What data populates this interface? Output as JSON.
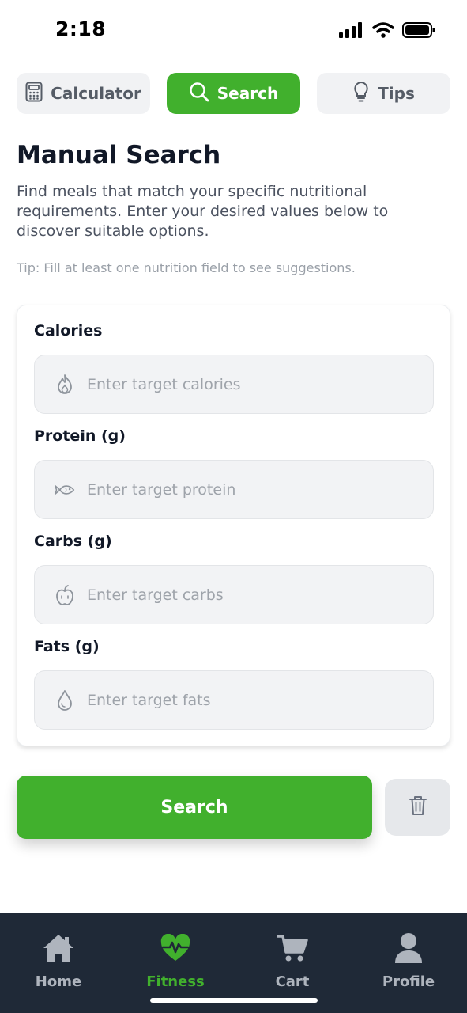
{
  "status_bar": {
    "time": "2:18"
  },
  "tabs": [
    {
      "label": "Calculator",
      "icon": "calculator-icon",
      "active": false
    },
    {
      "label": "Search",
      "icon": "search-icon",
      "active": true
    },
    {
      "label": "Tips",
      "icon": "lightbulb-icon",
      "active": false
    }
  ],
  "page": {
    "title": "Manual Search",
    "description": "Find meals that match your specific nutritional requirements. Enter your desired values below to discover suitable options.",
    "tip": "Tip: Fill at least one nutrition field to see suggestions."
  },
  "fields": [
    {
      "label": "Calories",
      "placeholder": "Enter target calories",
      "value": "",
      "icon": "flame-icon"
    },
    {
      "label": "Protein (g)",
      "placeholder": "Enter target protein",
      "value": "",
      "icon": "fish-icon"
    },
    {
      "label": "Carbs (g)",
      "placeholder": "Enter target carbs",
      "value": "",
      "icon": "apple-icon"
    },
    {
      "label": "Fats (g)",
      "placeholder": "Enter target fats",
      "value": "",
      "icon": "droplet-icon"
    }
  ],
  "actions": {
    "search_label": "Search",
    "clear_icon": "trash-icon"
  },
  "bottom_nav": [
    {
      "label": "Home",
      "icon": "home-icon",
      "active": false
    },
    {
      "label": "Fitness",
      "icon": "heart-pulse-icon",
      "active": true
    },
    {
      "label": "Cart",
      "icon": "cart-icon",
      "active": false
    },
    {
      "label": "Profile",
      "icon": "user-icon",
      "active": false
    }
  ],
  "colors": {
    "accent": "#41b02d",
    "nav_background": "#1f2937",
    "input_background": "#f2f3f5",
    "text_primary": "#111827",
    "text_muted": "#9aa0a8"
  }
}
